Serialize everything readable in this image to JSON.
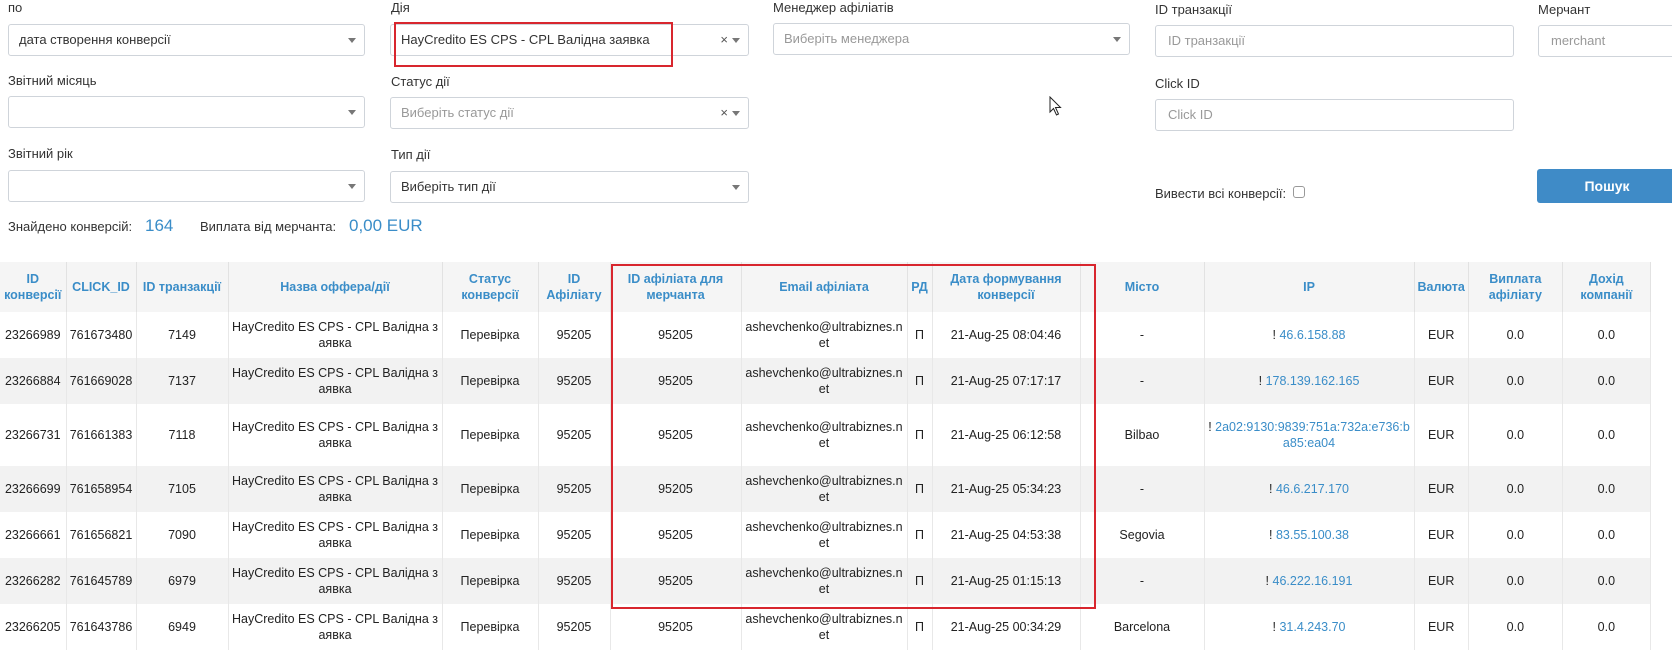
{
  "filters": {
    "by_label": "по",
    "by_value": "дата створення конверсії",
    "action_label": "Дія",
    "action_value": "HayCredito ES CPS - CPL Валідна заявка",
    "manager_label": "Менеджер афіліатів",
    "manager_placeholder": "Виберіть менеджера",
    "transaction_label": "ID транзакції",
    "transaction_placeholder": "ID транзакції",
    "merchant_label": "Мерчант",
    "merchant_placeholder": "merchant",
    "report_month_label": "Звітний місяць",
    "report_month_value": "",
    "action_status_label": "Статус дії",
    "action_status_placeholder": "Виберіть статус дії",
    "click_id_label": "Click ID",
    "click_id_placeholder": "Click ID",
    "report_year_label": "Звітний рік",
    "report_year_value": "",
    "action_type_label": "Тип дії",
    "action_type_placeholder": "Виберіть тип дії",
    "show_all_label": "Вивести всі конверсії:",
    "search_button": "Пошук",
    "clear_symbol": "×"
  },
  "summary": {
    "found_label": "Знайдено конверсій:",
    "found_value": "164",
    "payout_label": "Виплата від мерчанта:",
    "payout_value": "0,00 EUR"
  },
  "table": {
    "headers": [
      "ID конверсії",
      "CLICK_ID",
      "ID транзакції",
      "Назва оффера/дії",
      "Статус конверсії",
      "ID Афіліату",
      "ID афіліата для мерчанта",
      "Email афіліата",
      "РД",
      "Дата формування конверсії",
      "Місто",
      "IP",
      "Валюта",
      "Виплата афіліату",
      "Дохід компанії"
    ],
    "rows": [
      [
        "23266989",
        "761673480",
        "7149",
        "HayCredito ES CPS - CPL Валідна заявка",
        "Перевірка",
        "95205",
        "95205",
        "ashevchenko@ultrabiznes.net",
        "П",
        "21-Aug-25 08:04:46",
        "-",
        "46.6.158.88",
        "EUR",
        "0.0",
        "0.0"
      ],
      [
        "23266884",
        "761669028",
        "7137",
        "HayCredito ES CPS - CPL Валідна заявка",
        "Перевірка",
        "95205",
        "95205",
        "ashevchenko@ultrabiznes.net",
        "П",
        "21-Aug-25 07:17:17",
        "-",
        "178.139.162.165",
        "EUR",
        "0.0",
        "0.0"
      ],
      [
        "23266731",
        "761661383",
        "7118",
        "HayCredito ES CPS - CPL Валідна заявка",
        "Перевірка",
        "95205",
        "95205",
        "ashevchenko@ultrabiznes.net",
        "П",
        "21-Aug-25 06:12:58",
        "Bilbao",
        "2a02:9130:9839:751a:732a:e736:ba85:ea04",
        "EUR",
        "0.0",
        "0.0"
      ],
      [
        "23266699",
        "761658954",
        "7105",
        "HayCredito ES CPS - CPL Валідна заявка",
        "Перевірка",
        "95205",
        "95205",
        "ashevchenko@ultrabiznes.net",
        "П",
        "21-Aug-25 05:34:23",
        "-",
        "46.6.217.170",
        "EUR",
        "0.0",
        "0.0"
      ],
      [
        "23266661",
        "761656821",
        "7090",
        "HayCredito ES CPS - CPL Валідна заявка",
        "Перевірка",
        "95205",
        "95205",
        "ashevchenko@ultrabiznes.net",
        "П",
        "21-Aug-25 04:53:38",
        "Segovia",
        "83.55.100.38",
        "EUR",
        "0.0",
        "0.0"
      ],
      [
        "23266282",
        "761645789",
        "6979",
        "HayCredito ES CPS - CPL Валідна заявка",
        "Перевірка",
        "95205",
        "95205",
        "ashevchenko@ultrabiznes.net",
        "П",
        "21-Aug-25 01:15:13",
        "-",
        "46.222.16.191",
        "EUR",
        "0.0",
        "0.0"
      ],
      [
        "23266205",
        "761643786",
        "6949",
        "HayCredito ES CPS - CPL Валідна заявка",
        "Перевірка",
        "95205",
        "95205",
        "ashevchenko@ultrabiznes.net",
        "П",
        "21-Aug-25 00:34:29",
        "Barcelona",
        "31.4.243.70",
        "EUR",
        "0.0",
        "0.0"
      ]
    ],
    "ip_prefix": "!"
  },
  "colors": {
    "accent": "#3a8dc8",
    "highlight_box": "#d8262e",
    "search_button": "#3f8bc7"
  }
}
